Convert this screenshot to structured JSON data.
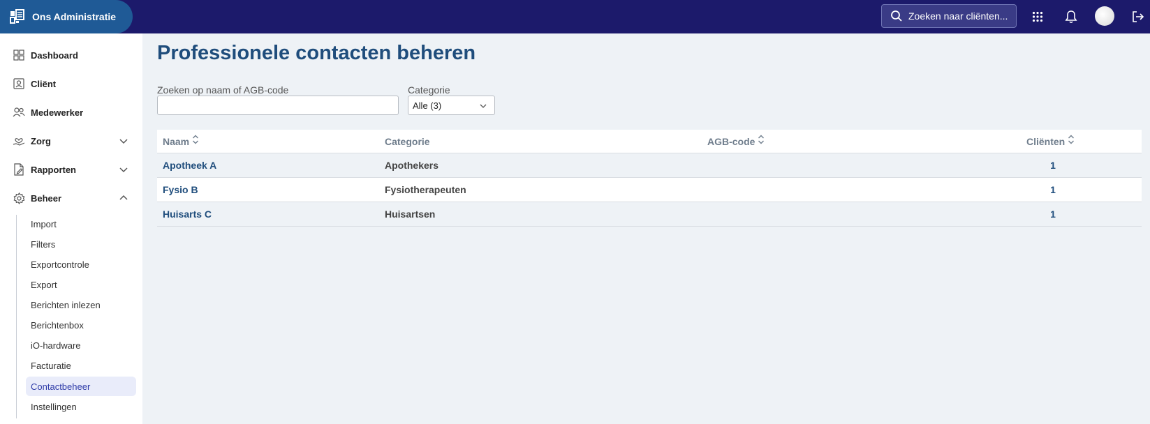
{
  "app": {
    "name": "Ons Administratie"
  },
  "topbar": {
    "search_placeholder": "Zoeken naar cliënten...",
    "icons": [
      "search-icon",
      "apps-grid-icon",
      "bell-icon",
      "avatar",
      "logout-icon"
    ]
  },
  "sidebar": {
    "items": [
      {
        "label": "Dashboard",
        "icon": "dashboard-icon",
        "expandable": false
      },
      {
        "label": "Cliënt",
        "icon": "client-icon",
        "expandable": false
      },
      {
        "label": "Medewerker",
        "icon": "users-icon",
        "expandable": false
      },
      {
        "label": "Zorg",
        "icon": "care-icon",
        "expandable": true,
        "expanded": false
      },
      {
        "label": "Rapporten",
        "icon": "report-icon",
        "expandable": true,
        "expanded": false
      },
      {
        "label": "Beheer",
        "icon": "gear-icon",
        "expandable": true,
        "expanded": true
      }
    ],
    "beheer_sub": [
      {
        "label": "Import"
      },
      {
        "label": "Filters"
      },
      {
        "label": "Exportcontrole"
      },
      {
        "label": "Export"
      },
      {
        "label": "Berichten inlezen"
      },
      {
        "label": "Berichtenbox"
      },
      {
        "label": "iO-hardware"
      },
      {
        "label": "Facturatie"
      },
      {
        "label": "Contactbeheer",
        "active": true
      },
      {
        "label": "Instellingen"
      }
    ]
  },
  "main": {
    "title": "Professionele contacten beheren",
    "search_label": "Zoeken op naam of AGB-code",
    "search_value": "",
    "category_label": "Categorie",
    "category_selected": "Alle (3)",
    "table": {
      "columns": [
        "Naam",
        "Categorie",
        "AGB-code",
        "Cliënten"
      ],
      "rows": [
        {
          "naam": "Apotheek A",
          "categorie": "Apothekers",
          "agb": "",
          "clienten": "1"
        },
        {
          "naam": "Fysio B",
          "categorie": "Fysiotherapeuten",
          "agb": "",
          "clienten": "1"
        },
        {
          "naam": "Huisarts C",
          "categorie": "Huisartsen",
          "agb": "",
          "clienten": "1"
        }
      ]
    }
  },
  "colors": {
    "topbar": "#1c1a6b",
    "brand": "#1f5a96",
    "title": "#1f4d7c",
    "active_sub_bg": "#e9ecfa",
    "active_sub_text": "#2e3ba8",
    "background": "#eef2f6"
  }
}
